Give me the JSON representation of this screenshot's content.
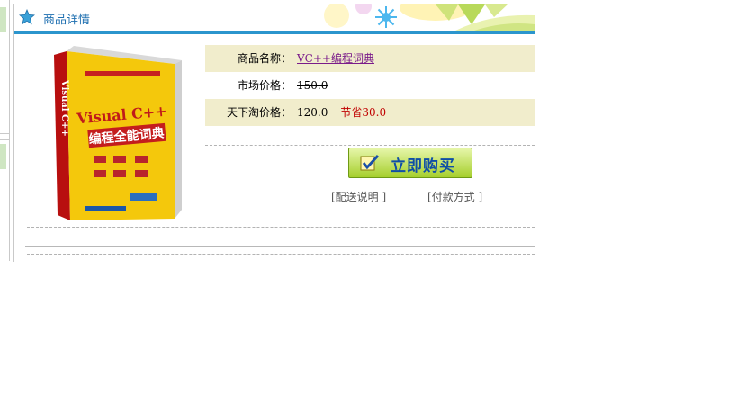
{
  "panel": {
    "title": "商品详情"
  },
  "product": {
    "name_label": "商品名称：",
    "name_value": "VC++编程词典",
    "market_label": "市场价格：",
    "market_value": "150.0",
    "price_label": "天下淘价格：",
    "price_value": "120.0",
    "save_prefix": "节省",
    "save_value": "30.0",
    "cover": {
      "title": "Visual C++",
      "subtitle": "编程全能词典",
      "spine": "Visual C++"
    }
  },
  "buy_button": {
    "label": "立即购买"
  },
  "links": {
    "delivery": "[配送说明 ]",
    "payment": "[付款方式 ]"
  },
  "colors": {
    "header_border": "#2b95cd",
    "title": "#1e6fb0",
    "row_shade": "#f1edcc",
    "save": "#c00000"
  }
}
